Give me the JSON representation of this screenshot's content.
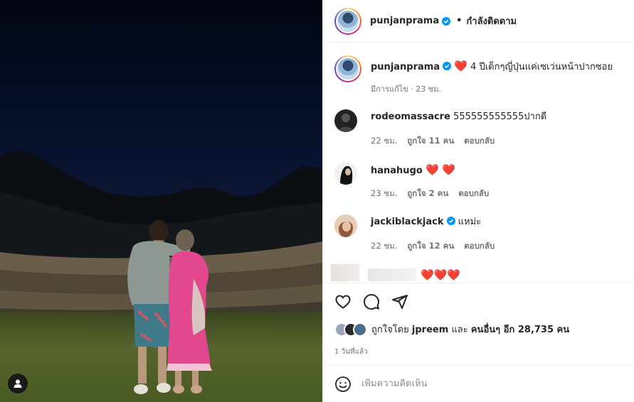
{
  "post": {
    "author": "punjanprama",
    "follow_state": "กำลังติดตาม",
    "follow_separator": "•",
    "caption_text": "4 ปีเด็กๆญี่ปุ่นแค่เซเว่นหน้าปากซอย",
    "caption_meta": "มีการแก้ไข · 23 ชม.",
    "photo_alt": "Couple looking at night sky over an amphitheater"
  },
  "comments": [
    {
      "user": "rodeomassacre",
      "text": "555555555555ปากดี",
      "verified": false,
      "time": "22 ชม.",
      "likes": "ถูกใจ 11 คน",
      "reply": "ตอบกลับ",
      "avatar_color": "#222222"
    },
    {
      "user": "hanahugo",
      "text": "",
      "hearts": "❤️ ❤️",
      "verified": false,
      "time": "23 ชม.",
      "likes": "ถูกใจ 2 คน",
      "reply": "ตอบกลับ",
      "avatar_color": "#111111"
    },
    {
      "user": "jackiblackjack",
      "text": "แหม่ะ",
      "verified": true,
      "time": "22 ชม.",
      "likes": "ถูกใจ 12 คน",
      "reply": "ตอบกลับ",
      "avatar_color": "#caa58a"
    }
  ],
  "blurred_comment_hearts": "❤️❤️❤️",
  "likes": {
    "prefix": "ถูกใจโดย",
    "first_user": "jpreem",
    "middle": "และ",
    "others": "คนอื่นๆ อีก 28,735 คน"
  },
  "time_ago": "1 วันที่แล้ว",
  "add_comment_placeholder": "เพิ่มความคิดเห็น",
  "colors": {
    "verified": "#0095f6",
    "heart": "#ed1a3a",
    "meta": "#737373"
  },
  "icons": [
    "heart-icon",
    "comment-icon",
    "share-icon",
    "emoji-icon",
    "user-tag-icon",
    "verified-icon"
  ]
}
